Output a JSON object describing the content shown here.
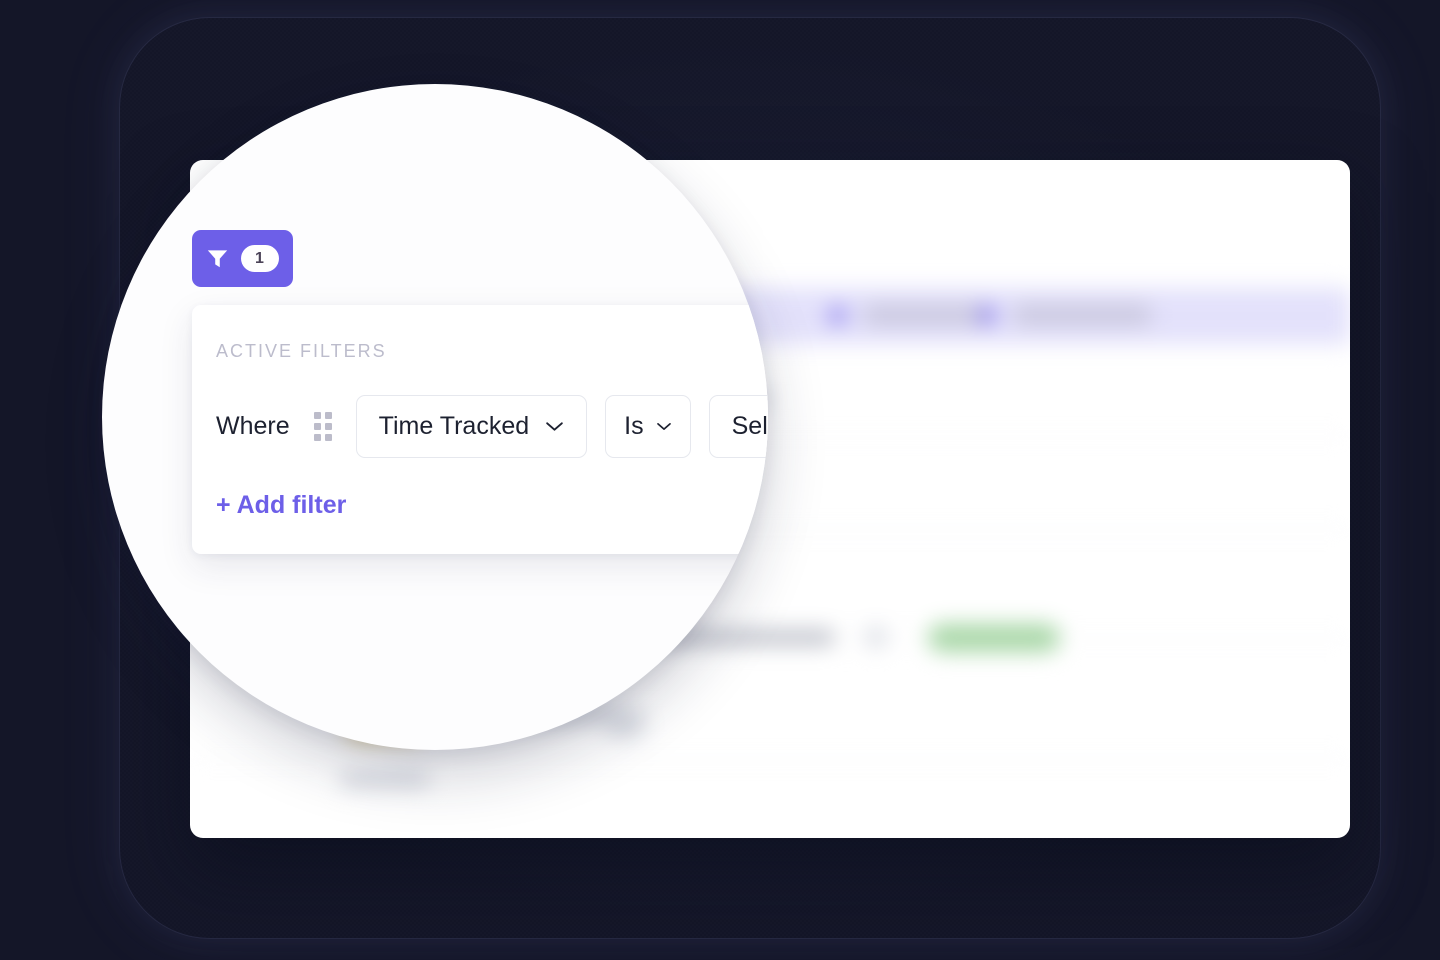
{
  "theme": {
    "backdrop_color": "#141628",
    "accent_purple": "#6D5FE8",
    "panel_background": "#FFFFFF",
    "lens_background": "#FDFDFE",
    "muted_label_color": "#BCBCCC",
    "text_color": "#1D2130",
    "border_color": "#E6E8EE",
    "status_green": "#A8D7A7"
  },
  "filter_button": {
    "icon": "funnel-icon",
    "count": "1"
  },
  "filter_panel": {
    "title": "ACTIVE FILTERS",
    "rows": [
      {
        "conjunction_label": "Where",
        "drag_handle": "drag-handle-icon",
        "field": {
          "value": "Time Tracked",
          "chevron": "chevron-down-icon"
        },
        "operator": {
          "value": "Is",
          "chevron": "chevron-down-icon"
        },
        "value_field": {
          "value": "Select",
          "placeholder": "Select"
        }
      }
    ],
    "add_filter_label": "+ Add filter"
  },
  "background_app": {
    "description": "blurred task table behind the magnifier lens",
    "selected_row_present": true,
    "status_badge_color": "#A8D7A7"
  }
}
